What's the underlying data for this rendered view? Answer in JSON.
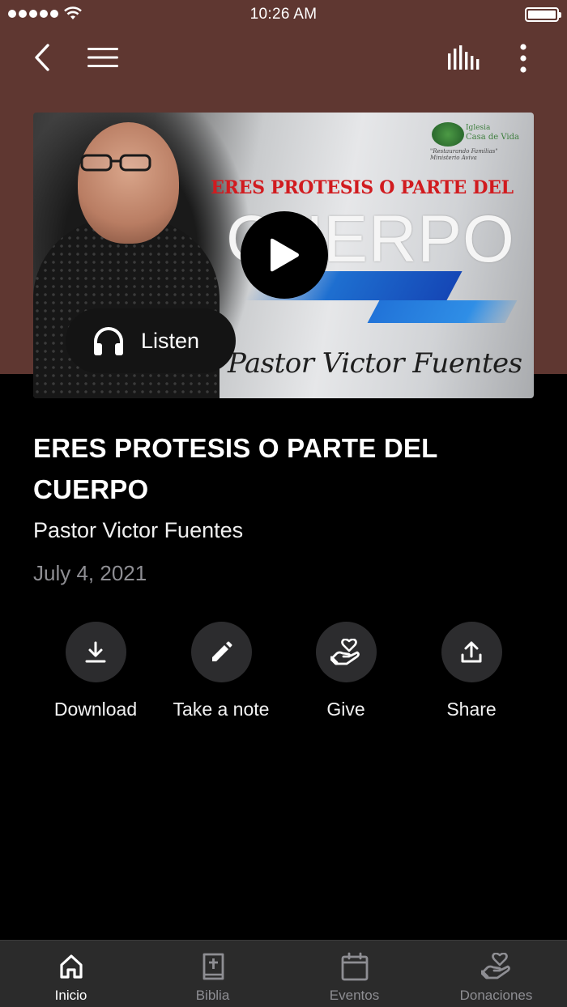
{
  "status_bar": {
    "time": "10:26 AM"
  },
  "colors": {
    "header_bg": "#5f3731",
    "page_bg": "#000000",
    "tab_active": "#ffffff",
    "tab_inactive": "#8e8e93",
    "action_circle": "#2c2c2e"
  },
  "header": {
    "icons": [
      "back-icon",
      "menu-icon",
      "audio-levels-icon",
      "more-vertical-icon"
    ]
  },
  "media": {
    "thumbnail": {
      "heading": "ERES PROTESIS O PARTE DEL",
      "big_word": "CUERPO",
      "signature": "Pastor Victor Fuentes",
      "logo_line1": "Iglesia",
      "logo_line2": "Casa de Vida",
      "logo_tagline": "\"Restaurando Familias\" Ministerio Aviva"
    },
    "listen_label": "Listen"
  },
  "sermon": {
    "title": "ERES PROTESIS O PARTE DEL CUERPO",
    "speaker": "Pastor Victor Fuentes",
    "date": "July 4, 2021"
  },
  "actions": [
    {
      "label": "Download",
      "icon": "download-icon"
    },
    {
      "label": "Take a note",
      "icon": "pencil-icon"
    },
    {
      "label": "Give",
      "icon": "heart-hand-icon"
    },
    {
      "label": "Share",
      "icon": "share-icon"
    }
  ],
  "tabs": [
    {
      "label": "Inicio",
      "icon": "home-icon",
      "active": true
    },
    {
      "label": "Biblia",
      "icon": "bible-icon",
      "active": false
    },
    {
      "label": "Eventos",
      "icon": "calendar-icon",
      "active": false
    },
    {
      "label": "Donaciones",
      "icon": "heart-hand-icon",
      "active": false
    }
  ]
}
